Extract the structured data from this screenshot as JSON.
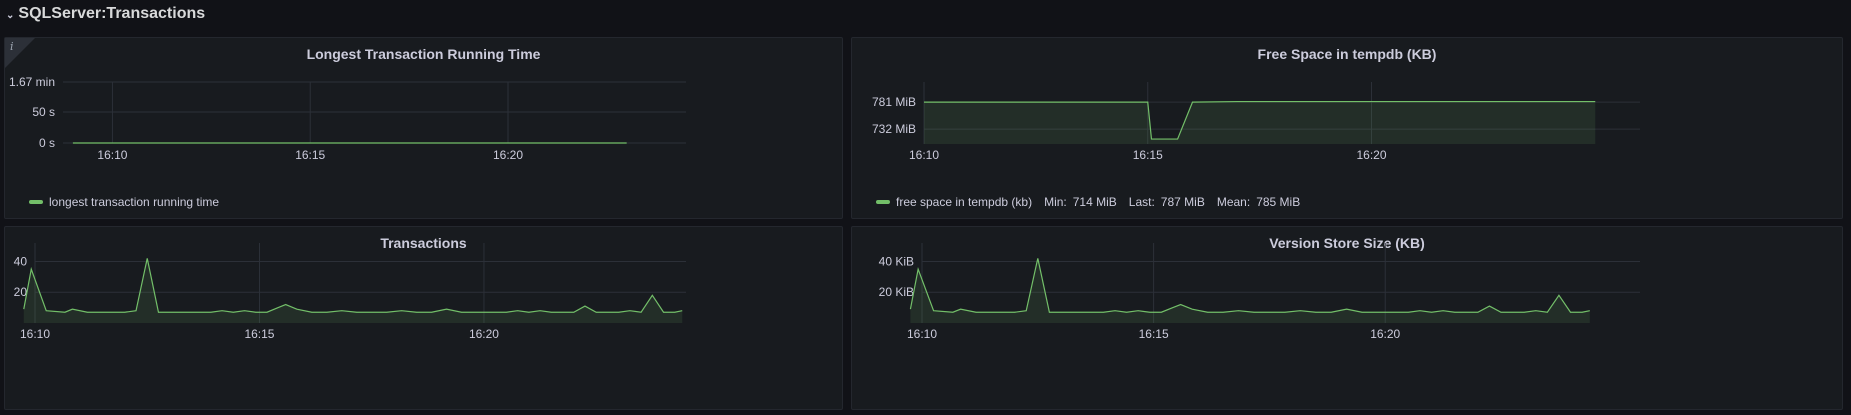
{
  "row": {
    "title": "SQLServer:Transactions"
  },
  "colors": {
    "series": "#73bf69",
    "grid": "#2c3038",
    "axis": "#ccccdc"
  },
  "panels": {
    "longest": {
      "title": "Longest Transaction Running Time",
      "info_icon": "info-icon",
      "yticks": [
        "1.67 min",
        "50 s",
        "0 s"
      ],
      "xticks": [
        "16:10",
        "16:15",
        "16:20"
      ],
      "legend": "longest transaction running time"
    },
    "freespace": {
      "title": "Free Space in tempdb (KB)",
      "yticks": [
        "781 MiB",
        "732 MiB"
      ],
      "xticks": [
        "16:10",
        "16:15",
        "16:20"
      ],
      "legend": "free space in tempdb (kb)",
      "stats": {
        "min_label": "Min:",
        "min": "714 MiB",
        "last_label": "Last:",
        "last": "787 MiB",
        "mean_label": "Mean:",
        "mean": "785 MiB"
      }
    },
    "transactions": {
      "title": "Transactions",
      "yticks": [
        "40",
        "20"
      ],
      "xticks": [
        "16:10",
        "16:15",
        "16:20"
      ]
    },
    "version": {
      "title": "Version Store Size (KB)",
      "yticks": [
        "40 KiB",
        "20 KiB"
      ],
      "xticks": [
        "16:10",
        "16:15",
        "16:20"
      ]
    }
  },
  "chart_data": [
    {
      "type": "line",
      "title": "Longest Transaction Running Time",
      "x_range": [
        "16:08:45",
        "16:24:30"
      ],
      "ylim": [
        0,
        100
      ],
      "y_unit": "seconds",
      "series": [
        {
          "name": "longest transaction running time",
          "x": [
            "16:09",
            "16:23"
          ],
          "y": [
            0,
            0
          ]
        }
      ]
    },
    {
      "type": "area",
      "title": "Free Space in tempdb (KB)",
      "x_range": [
        "16:10:00",
        "16:26:00"
      ],
      "ylim": [
        705,
        803
      ],
      "y_unit": "MiB",
      "series": [
        {
          "name": "free space in tempdb (kb)",
          "x": [
            "16:10",
            "16:11",
            "16:12",
            "16:13",
            "16:14",
            "16:15",
            "16:15:05",
            "16:15:40",
            "16:16",
            "16:17",
            "16:18",
            "16:19",
            "16:20",
            "16:21",
            "16:22",
            "16:23",
            "16:24",
            "16:25"
          ],
          "y": [
            781,
            781,
            781,
            781,
            781,
            781,
            714,
            714,
            781,
            782,
            782,
            782,
            782,
            782,
            782,
            782,
            782,
            782
          ]
        }
      ]
    },
    {
      "type": "area",
      "title": "Transactions",
      "x_range": [
        "16:10:00",
        "16:24:30"
      ],
      "ylim": [
        0,
        52
      ],
      "series": [
        {
          "name": "",
          "x": [
            "16:09:45",
            "16:09:55",
            "16:10:15",
            "16:10:40",
            "16:10:50",
            "16:11:10",
            "16:11:30",
            "16:12:00",
            "16:12:15",
            "16:12:30",
            "16:12:45",
            "16:13:00",
            "16:13:40",
            "16:13:55",
            "16:14:10",
            "16:14:25",
            "16:14:40",
            "16:14:55",
            "16:15:10",
            "16:15:25",
            "16:15:35",
            "16:15:50",
            "16:16:10",
            "16:16:30",
            "16:16:50",
            "16:17:10",
            "16:17:30",
            "16:17:50",
            "16:18:10",
            "16:18:30",
            "16:18:50",
            "16:19:10",
            "16:19:30",
            "16:19:50",
            "16:20:10",
            "16:20:30",
            "16:20:45",
            "16:21:00",
            "16:21:15",
            "16:21:30",
            "16:21:45",
            "16:22:00",
            "16:22:15",
            "16:22:30",
            "16:22:45",
            "16:23:00",
            "16:23:15",
            "16:23:30",
            "16:23:45",
            "16:24:00",
            "16:24:15",
            "16:24:25"
          ],
          "y": [
            9,
            35,
            8,
            7,
            9,
            7,
            7,
            7,
            8,
            42,
            7,
            7,
            7,
            7,
            8,
            7,
            8,
            7,
            7,
            10,
            12,
            9,
            7,
            7,
            8,
            7,
            7,
            7,
            8,
            7,
            7,
            9,
            7,
            7,
            7,
            7,
            8,
            7,
            8,
            7,
            7,
            7,
            11,
            7,
            7,
            7,
            8,
            7,
            18,
            7,
            7,
            8
          ]
        }
      ]
    },
    {
      "type": "area",
      "title": "Version Store Size (KB)",
      "x_range": [
        "16:10:00",
        "16:25:30"
      ],
      "ylim": [
        0,
        52
      ],
      "y_unit": "KiB",
      "series": [
        {
          "name": "",
          "x": [
            "16:09:45",
            "16:09:55",
            "16:10:15",
            "16:10:40",
            "16:10:50",
            "16:11:10",
            "16:11:30",
            "16:12:00",
            "16:12:15",
            "16:12:30",
            "16:12:45",
            "16:13:00",
            "16:13:40",
            "16:13:55",
            "16:14:10",
            "16:14:25",
            "16:14:40",
            "16:14:55",
            "16:15:10",
            "16:15:25",
            "16:15:35",
            "16:15:50",
            "16:16:10",
            "16:16:30",
            "16:16:50",
            "16:17:10",
            "16:17:30",
            "16:17:50",
            "16:18:10",
            "16:18:30",
            "16:18:50",
            "16:19:10",
            "16:19:30",
            "16:19:50",
            "16:20:10",
            "16:20:30",
            "16:20:45",
            "16:21:00",
            "16:21:15",
            "16:21:30",
            "16:21:45",
            "16:22:00",
            "16:22:15",
            "16:22:30",
            "16:22:45",
            "16:23:00",
            "16:23:15",
            "16:23:30",
            "16:23:45",
            "16:24:00",
            "16:24:15",
            "16:24:25"
          ],
          "y": [
            9,
            35,
            8,
            7,
            9,
            7,
            7,
            7,
            8,
            42,
            7,
            7,
            7,
            7,
            8,
            7,
            8,
            7,
            7,
            10,
            12,
            9,
            7,
            7,
            8,
            7,
            7,
            7,
            8,
            7,
            7,
            9,
            7,
            7,
            7,
            7,
            8,
            7,
            8,
            7,
            7,
            7,
            11,
            7,
            7,
            7,
            8,
            7,
            18,
            7,
            7,
            8
          ]
        }
      ]
    }
  ]
}
